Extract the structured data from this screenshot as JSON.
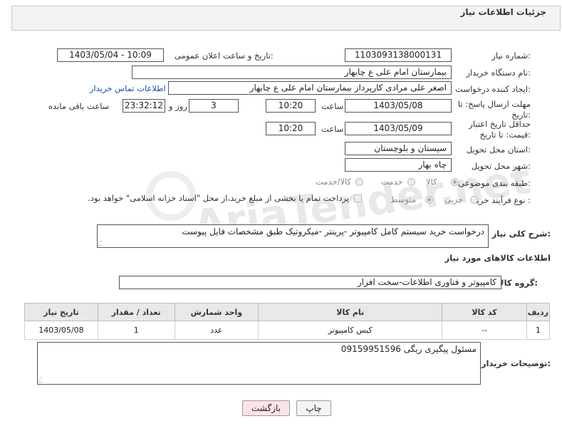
{
  "panel": {
    "title": "جزئیات اطلاعات نیاز"
  },
  "watermark": "AriaTender.net",
  "fields": {
    "need_number": {
      "label": "شماره نیاز:",
      "value": "1103093138000131"
    },
    "announce_dt": {
      "label": "تاریخ و ساعت اعلان عمومی:",
      "value": "1403/05/04 - 10:09"
    },
    "buyer_org": {
      "label": "نام دستگاه خریدار:",
      "value": "بیمارستان امام علی  ع  چابهار"
    },
    "requester": {
      "label": "ایجاد کننده درخواست:",
      "value": "اصغر علی مرادی کارپرداز بیمارستان امام علی  ع  چابهار",
      "contact_link": "اطلاعات تماس خریدار"
    },
    "reply_deadline": {
      "label": "مهلت ارسال پاسخ: تا تاریخ:",
      "date": "1403/05/08",
      "time_label": "ساعت",
      "time": "10:20",
      "days": "3",
      "days_label": "روز و",
      "remaining": "23:32:12",
      "remaining_label": "ساعت باقی مانده"
    },
    "price_validity": {
      "label": "حداقل تاریخ اعتبار قیمت: تا تاریخ:",
      "date": "1403/05/09",
      "time_label": "ساعت",
      "time": "10:20"
    },
    "province": {
      "label": "استان محل تحویل:",
      "value": "سیستان و بلوچستان"
    },
    "city": {
      "label": "شهر محل تحویل:",
      "value": "چاه بهار"
    },
    "category": {
      "label": "طبقه بندی موضوعی:",
      "options": [
        "کالا",
        "خدمت",
        "کالا/خدمت"
      ],
      "selected": "کالا"
    },
    "purchase_type": {
      "label": "نوع فرآیند خرید :",
      "options": [
        "جزیی",
        "متوسط"
      ],
      "selected": "متوسط",
      "note": "پرداخت تمام یا بخشی از مبلغ خرید،از محل \"اسناد خزانه اسلامی\" خواهد بود."
    }
  },
  "description": {
    "label": "شرح کلی نیاز:",
    "value": "درخواست خرید سیستم کامل کامپیوتر -پرینتر -میکروتیک طبق مشخصات فایل پیوست"
  },
  "goods_section": {
    "title": "اطلاعات کالاهای مورد نیاز"
  },
  "goods_group": {
    "label": "گروه کالا:",
    "value": "کامپیوتر و فناوری اطلاعات-سخت افزار"
  },
  "items_table": {
    "headers": [
      "ردیف",
      "کد کالا",
      "نام کالا",
      "واحد شمارش",
      "تعداد / مقدار",
      "تاریخ نیاز"
    ],
    "rows": [
      [
        "1",
        "--",
        "کیس کامپیوتر",
        "عدد",
        "1",
        "1403/05/08"
      ]
    ]
  },
  "buyer_notes": {
    "label": "توضیحات خریدار:",
    "value": "مسئول پیگیری ریگی 09159951596"
  },
  "buttons": {
    "print": "چاپ",
    "back": "بازگشت"
  },
  "colors": {
    "back_button_bg": "#fde4e4",
    "print_button_bg": "#f4f4f4",
    "link": "#1a4fa3"
  }
}
